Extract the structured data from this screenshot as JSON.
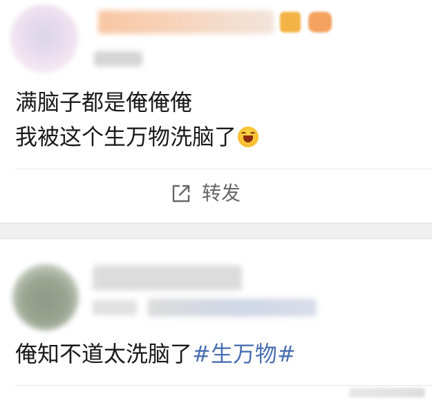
{
  "post1": {
    "text_line1": "满脑子都是俺俺俺",
    "text_line2": "我被这个生万物洗脑了",
    "emoji": "grinning-face-emoji",
    "repost_label": "转发",
    "repost_icon": "share-arrow-icon"
  },
  "post2": {
    "text": "俺知不道太洗脑了",
    "hashtag": "#生万物#"
  },
  "colors": {
    "hashtag": "#4a6fb0",
    "background": "#ffffff",
    "separator": "#efefef"
  }
}
